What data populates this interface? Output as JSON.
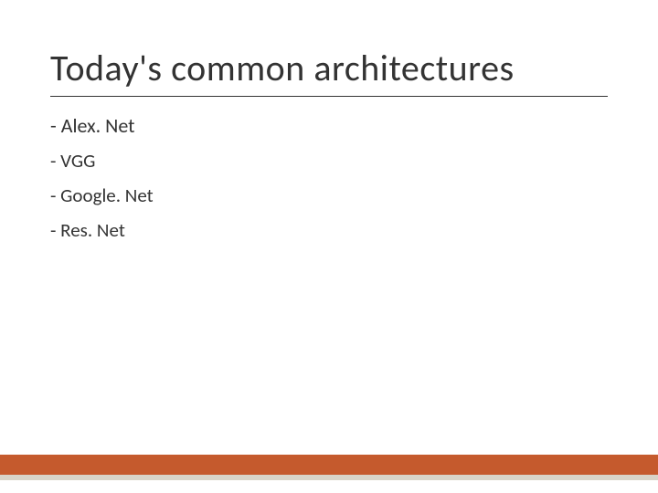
{
  "slide": {
    "title": "Today's common architectures",
    "bullets": [
      "- Alex. Net",
      "- VGG",
      "- Google. Net",
      "- Res. Net"
    ]
  },
  "colors": {
    "accent": "#c55a2d",
    "sub": "#d9d4c8"
  }
}
